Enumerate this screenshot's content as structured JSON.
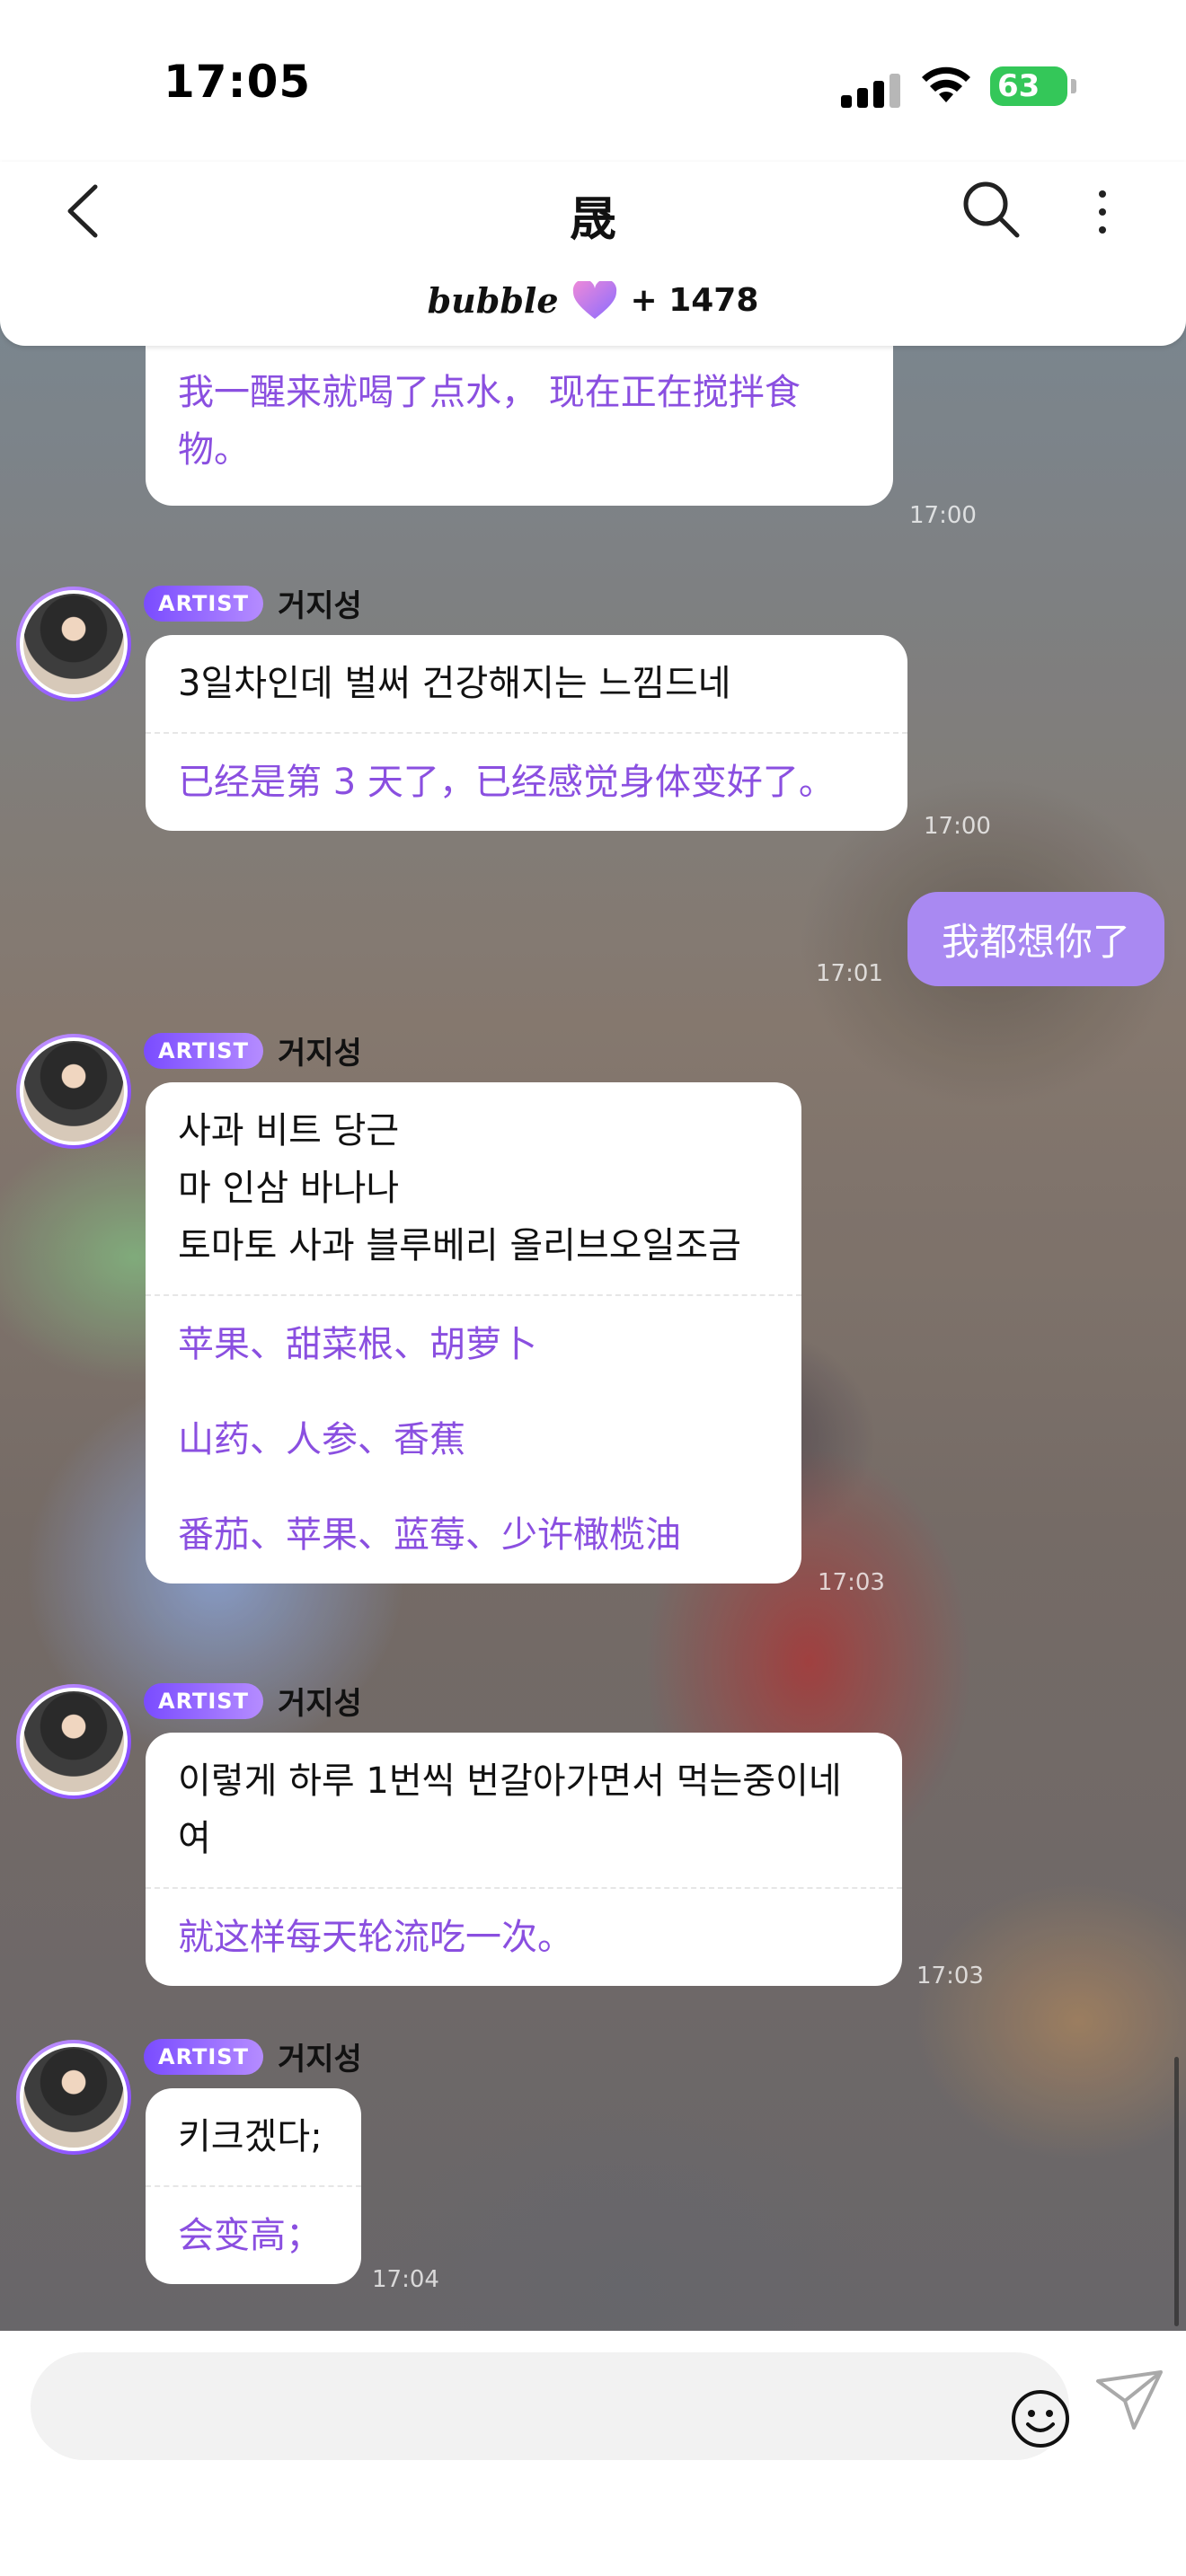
{
  "status_bar": {
    "time": "17:05",
    "battery": "63"
  },
  "header": {
    "title": "晟",
    "brand": "bubble",
    "subscriber_count": "+ 1478"
  },
  "messages": [
    {
      "type": "artist_partial",
      "translation": "我一醒来就喝了点水， 现在正在搅拌食物。",
      "time": "17:00"
    },
    {
      "type": "artist",
      "badge": "ARTIST",
      "name": "거지성",
      "korean": "3일차인데 벌써 건강해지는 느낌드네",
      "translation": "已经是第 3 天了，已经感觉身体变好了。",
      "time": "17:00"
    },
    {
      "type": "mine",
      "text": "我都想你了",
      "time": "17:01"
    },
    {
      "type": "artist",
      "badge": "ARTIST",
      "name": "거지성",
      "korean_lines": [
        "사과 비트 당근",
        "마 인삼 바나나",
        "토마토 사과 블루베리 올리브오일조금"
      ],
      "translation_lines": [
        "苹果、甜菜根、胡萝卜",
        "山药、人参、香蕉",
        "番茄、苹果、蓝莓、少许橄榄油"
      ],
      "time": "17:03"
    },
    {
      "type": "artist",
      "badge": "ARTIST",
      "name": "거지성",
      "korean": "이렇게 하루 1번씩 번갈아가면서 먹는중이네여",
      "translation": "就这样每天轮流吃一次。",
      "time": "17:03"
    },
    {
      "type": "artist",
      "badge": "ARTIST",
      "name": "거지성",
      "korean": "키크겠다;",
      "translation": "会变高；",
      "time": "17:04"
    }
  ],
  "icons": {
    "back": "chevron-left-icon",
    "search": "search-icon",
    "more": "more-vertical-icon",
    "emoji": "smiley-icon",
    "send": "paper-plane-icon"
  },
  "colors": {
    "accent_purple": "#8a4fe0",
    "my_bubble": "#a989f2",
    "battery_green": "#34c759"
  }
}
